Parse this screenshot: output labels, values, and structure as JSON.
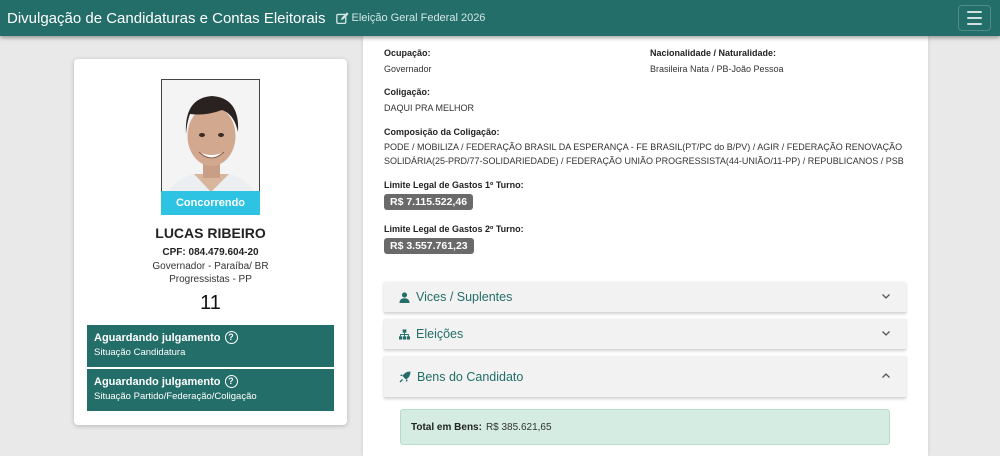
{
  "header": {
    "brand": "Divulgação de Candidaturas e Contas Eleitorais",
    "election": "Eleição Geral Federal 2026",
    "colors": {
      "primary": "#236e69",
      "status_badge": "#2ec3e2"
    },
    "icons": {
      "election": "edit-icon",
      "menu": "hamburger-menu-icon"
    }
  },
  "candidate": {
    "status": "Concorrendo",
    "name": "LUCAS RIBEIRO",
    "cpf": "CPF: 084.479.604-20",
    "office": "Governador - Paraíba/ BR",
    "party": "Progressistas - PP",
    "number": "11",
    "situations": [
      {
        "title": "Aguardando julgamento",
        "subtitle": "Situação Candidatura"
      },
      {
        "title": "Aguardando julgamento",
        "subtitle": "Situação Partido/Federação/Coligação"
      }
    ]
  },
  "details": {
    "occupation_label": "Ocupação:",
    "occupation": "Governador",
    "nationality_label": "Nacionalidade / Naturalidade:",
    "nationality": "Brasileira Nata / PB-João Pessoa",
    "coalition_label": "Coligação:",
    "coalition": "DAQUI PRA MELHOR",
    "composition_label": "Composição da Coligação:",
    "composition_line1": "PODE / MOBILIZA / FEDERAÇÃO BRASIL DA ESPERANÇA - FE BRASIL(PT/PC do B/PV) / AGIR / FEDERAÇÃO RENOVAÇÃO",
    "composition_line2": "SOLIDÁRIA(25-PRD/77-SOLIDARIEDADE) / FEDERAÇÃO UNIÃO PROGRESSISTA(44-UNIÃO/11-PP) / REPUBLICANOS / PSB",
    "limit1_label": "Limite Legal de Gastos 1º Turno:",
    "limit1": "R$ 7.115.522,46",
    "limit2_label": "Limite Legal de Gastos 2º Turno:",
    "limit2": "R$ 3.557.761,23"
  },
  "accordions": [
    {
      "title": "Vices / Suplentes",
      "icon": "person-icon",
      "state": "collapsed"
    },
    {
      "title": "Eleições",
      "icon": "sitemap-icon",
      "state": "collapsed"
    },
    {
      "title": "Bens do Candidato",
      "icon": "rocket-icon",
      "state": "expanded"
    }
  ],
  "assets": {
    "total_label": "Total em Bens:",
    "total_value": "R$ 385.621,65"
  }
}
